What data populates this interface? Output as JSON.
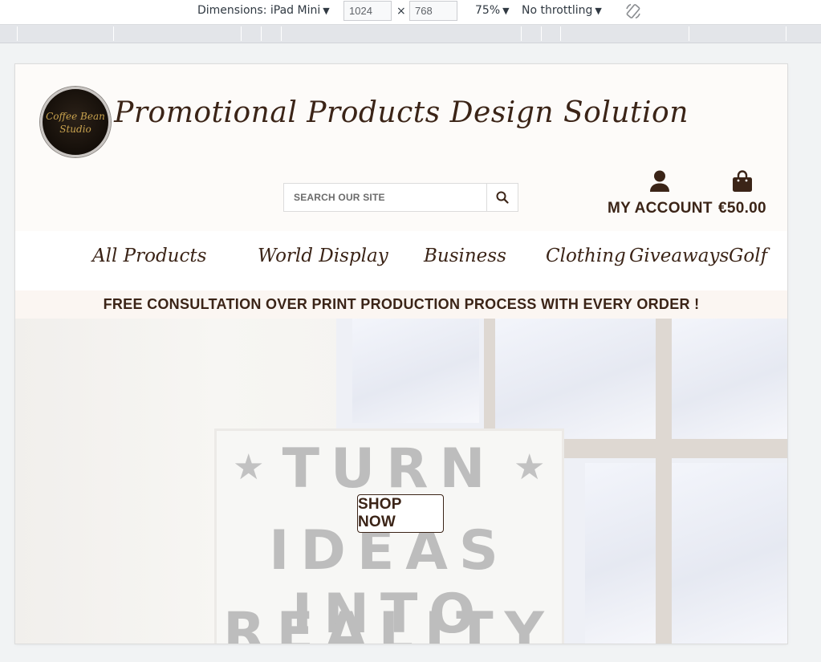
{
  "devtools": {
    "dimensions_label": "Dimensions: iPad Mini",
    "width_value": "1024",
    "height_value": "768",
    "times": "×",
    "zoom": "75%",
    "throttling": "No throttling",
    "caret": "▼"
  },
  "site": {
    "logo_text": "Coffee Bean\nStudio",
    "title": "Promotional Products Design Solution",
    "search": {
      "placeholder": "SEARCH OUR SITE"
    },
    "account_label": "MY ACCOUNT",
    "cart_total": "€50.00",
    "nav": [
      {
        "label": "All Products"
      },
      {
        "label": "World Display"
      },
      {
        "label": "Business"
      },
      {
        "label": "Clothing"
      },
      {
        "label": "Giveaways"
      },
      {
        "label": "Golf"
      }
    ],
    "banner": "FREE CONSULTATION OVER PRINT PRODUCTION PROCESS WITH EVERY ORDER !",
    "hero": {
      "lightbox_lines": [
        "TURN",
        "IDEAS INTO",
        "REALITY"
      ],
      "star": "★",
      "cta": "SHOP NOW"
    }
  },
  "colors": {
    "brand_brown": "#3b2417",
    "page_background": "#fdfbf9",
    "navbar_background": "#ffffff",
    "banner_background": "#fbf6f2"
  },
  "icons": [
    "rotate-device-icon",
    "search-icon",
    "user-icon",
    "shopping-bag-icon"
  ]
}
